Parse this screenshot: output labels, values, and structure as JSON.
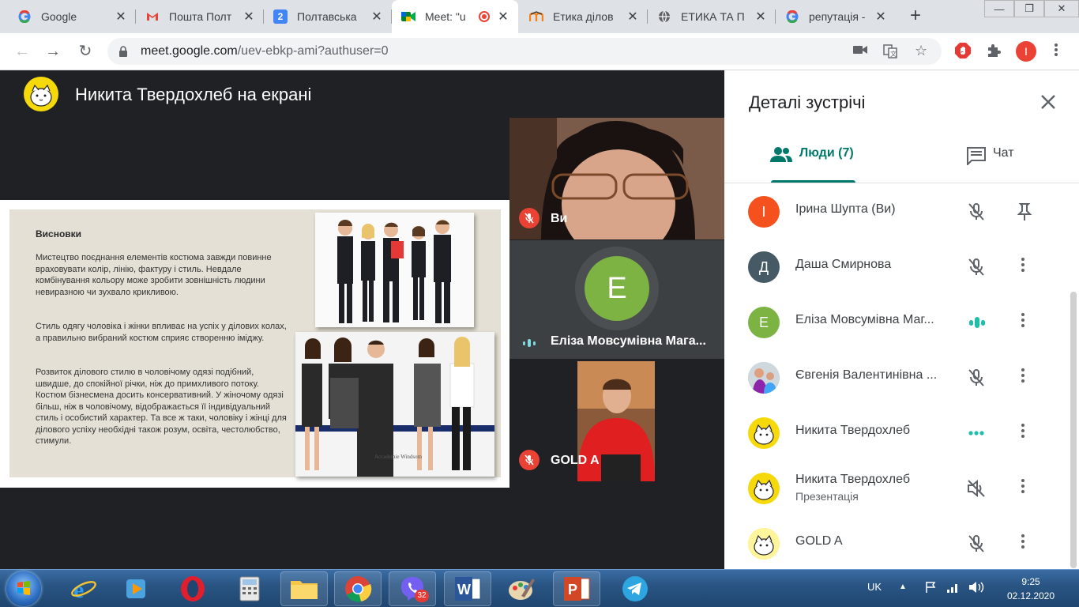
{
  "browser": {
    "tabs": [
      {
        "title": "Google",
        "favicon": "google-icon"
      },
      {
        "title": "Пошта Полт",
        "favicon": "gmail-icon"
      },
      {
        "title": "Полтавська",
        "favicon": "calendar-icon",
        "favicon_text": "2"
      },
      {
        "title": "Meet: \"u",
        "favicon": "meet-icon",
        "active": true,
        "recording": true
      },
      {
        "title": "Етика ділов",
        "favicon": "moodle-icon"
      },
      {
        "title": "ЕТИКА ТА П",
        "favicon": "globe-icon"
      },
      {
        "title": "репутація -",
        "favicon": "google-icon"
      }
    ],
    "address": {
      "host": "meet.google.com",
      "path": "/uev-ebkp-ami?authuser=0"
    },
    "profile_initial": "I"
  },
  "meet": {
    "presenter_title": "Никита Твердохлеб на екрані",
    "slide": {
      "heading": "Висновки",
      "paragraphs": [
        "Мистецтво поєднання елементів костюма завжди повинне враховувати колір, лінію, фактуру і стиль. Невдале комбінування кольору може зробити зовнішність людини невиразною чи зухвало крикливою.",
        "Стиль одягу чоловіка і жінки впливає на успіх у ділових колах, а правильно вибраний костюм сприяє створенню іміджу.",
        "Розвиток ділового стилю в чоловічому одязі подібний, швидше, до спокійної річки, ніж до примхливого потоку. Костюм бізнесмена досить консервативний. У жіночому одязі більш, ніж в чоловічому, відображається її індивідуальний стиль і особистий характер. Та все ж таки, чоловіку і жінці для ділового успіху необхідні також розум, освіта, честолюбство, стимули."
      ]
    },
    "tiles": [
      {
        "name": "Ви",
        "muted": true
      },
      {
        "name": "Еліза Мовсумівна Мага...",
        "initial": "Е",
        "speaking": true
      },
      {
        "name": "GOLD A",
        "muted": true
      }
    ]
  },
  "panel": {
    "title": "Деталі зустрічі",
    "tab_people": "Люди (7)",
    "tab_chat": "Чат",
    "people": [
      {
        "name": "Ірина Шупта (Ви)",
        "initial": "I",
        "color": "#f4511e",
        "status": "mic-off",
        "action": "pin"
      },
      {
        "name": "Даша Смирнова",
        "initial": "Д",
        "color": "#455a64",
        "status": "mic-off",
        "action": "more"
      },
      {
        "name": "Еліза Мовсумівна Маг...",
        "initial": "Е",
        "color": "#7cb342",
        "status": "speaking",
        "action": "more"
      },
      {
        "name": "Євгенія Валентинівна ...",
        "initial": "",
        "color": "#b0bec5",
        "status": "mic-off",
        "action": "more"
      },
      {
        "name": "Никита Твердохлеб",
        "initial": "",
        "color": "#f5d90a",
        "status": "dots",
        "action": "more"
      },
      {
        "name": "Никита Твердохлеб",
        "sub": "Презентація",
        "initial": "",
        "color": "#f5d90a",
        "status": "sound-off",
        "action": "more"
      },
      {
        "name": "GOLD A",
        "initial": "",
        "color": "#f5d90a",
        "status": "mic-off",
        "action": "more"
      }
    ]
  },
  "taskbar": {
    "viber_badge": "32",
    "lang": "UK",
    "time": "9:25",
    "date": "02.12.2020"
  }
}
